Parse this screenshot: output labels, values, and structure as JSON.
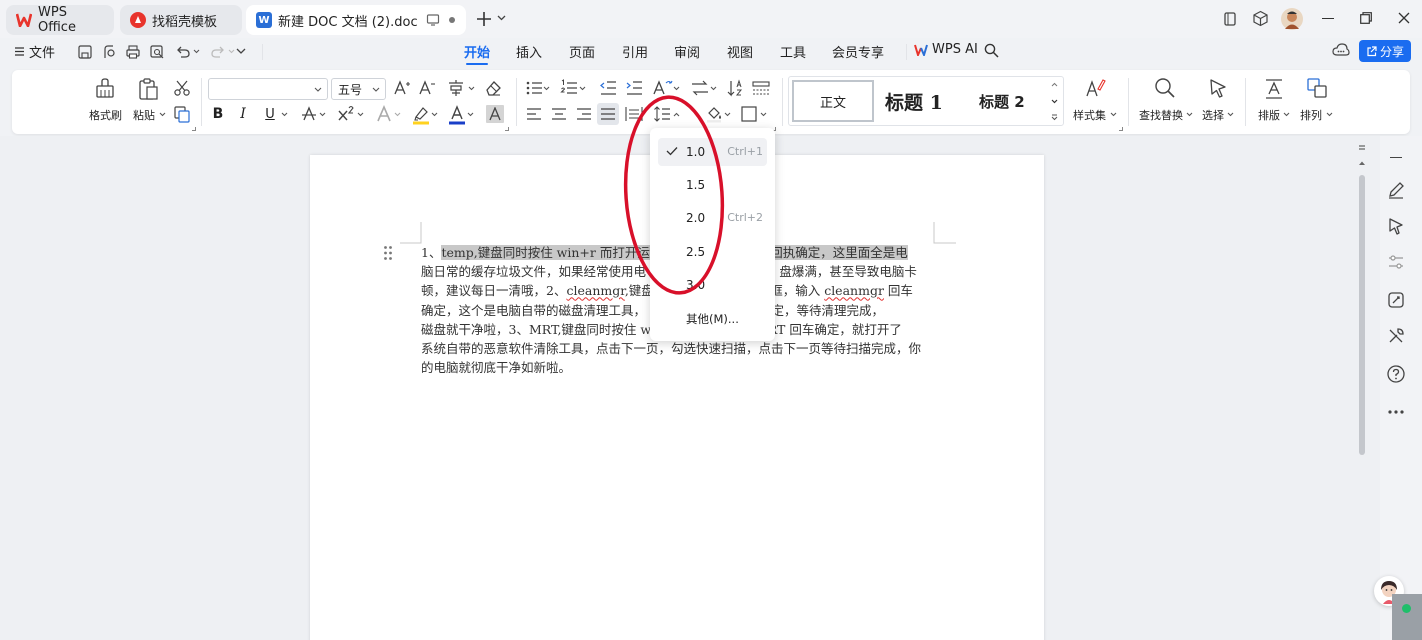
{
  "titlebar": {
    "tabs": [
      {
        "label": "WPS Office",
        "icon": "wps-logo-icon",
        "state": "inactive"
      },
      {
        "label": "找稻壳模板",
        "icon": "docer-logo-icon",
        "state": "inactive"
      },
      {
        "label": "新建 DOC 文档 (2).doc",
        "icon": "word-doc-icon",
        "state": "active"
      }
    ]
  },
  "menubar": {
    "file_label": "文件",
    "tabs": [
      "开始",
      "插入",
      "页面",
      "引用",
      "审阅",
      "视图",
      "工具",
      "会员专享"
    ],
    "active_tab": "开始",
    "wps_ai": "WPS AI",
    "share": "分享"
  },
  "ribbon": {
    "format_painter": "格式刷",
    "paste": "粘贴",
    "font_name": "",
    "font_size": "五号",
    "styles": {
      "normal": "正文",
      "heading1": "标题 1",
      "heading2": "标题 2"
    },
    "style_set": "样式集",
    "find_replace": "查找替换",
    "select": "选择",
    "layout": "排版",
    "arrange": "排列",
    "bold": "B",
    "italic": "I",
    "underline": "U"
  },
  "line_spacing_menu": {
    "items": [
      {
        "value": "1.0",
        "shortcut": "Ctrl+1",
        "checked": true
      },
      {
        "value": "1.5",
        "shortcut": "",
        "checked": false
      },
      {
        "value": "2.0",
        "shortcut": "Ctrl+2",
        "checked": false
      },
      {
        "value": "2.5",
        "shortcut": "",
        "checked": false
      },
      {
        "value": "3.0",
        "shortcut": "",
        "checked": false
      }
    ],
    "other": "其他(M)..."
  },
  "document": {
    "lines": [
      [
        {
          "t": "1、"
        },
        {
          "t": "temp,键盘同时按住 win+r 而打开运行",
          "hl": true
        },
        {
          "t": "                        "
        },
        {
          "t": "号回执确定，这里面全是电",
          "hl": true
        }
      ],
      [
        {
          "t": "脑日常的缓存垃圾文件，如果经常使用电"
        },
        {
          "t": "                          "
        },
        {
          "t": "致 C 盘爆满，甚至导致电脑卡"
        }
      ],
      [
        {
          "t": "顿，建议每日一清哦，2、"
        },
        {
          "t": "cleanmgr",
          "sq": true
        },
        {
          "t": ",键盘"
        },
        {
          "t": "                       "
        },
        {
          "t": "运行框，输入 "
        },
        {
          "t": "cleanmgr",
          "sq": true
        },
        {
          "t": " 回车"
        }
      ],
      [
        {
          "t": "确定，这个是电脑自带的磁盘清理工具，"
        },
        {
          "t": "                   "
        },
        {
          "t": "，点击确定，等待清理完成，"
        }
      ],
      [
        {
          "t": "磁盘就干净啦，3、MRT,键盘同时按住 wi"
        },
        {
          "t": "                     "
        },
        {
          "t": "入 MRT 回车确定，就打开了"
        }
      ],
      [
        {
          "t": "系统自带的恶意软件清除工具，点击下一页，勾选快速扫描，点击下一页等待扫描完成，你"
        }
      ],
      [
        {
          "t": "的电脑就彻底干净如新啦。"
        }
      ]
    ]
  },
  "colors": {
    "accent": "#1a6cf0",
    "annotation_circle": "#d8102a",
    "highlight": "#c8c8c8"
  }
}
